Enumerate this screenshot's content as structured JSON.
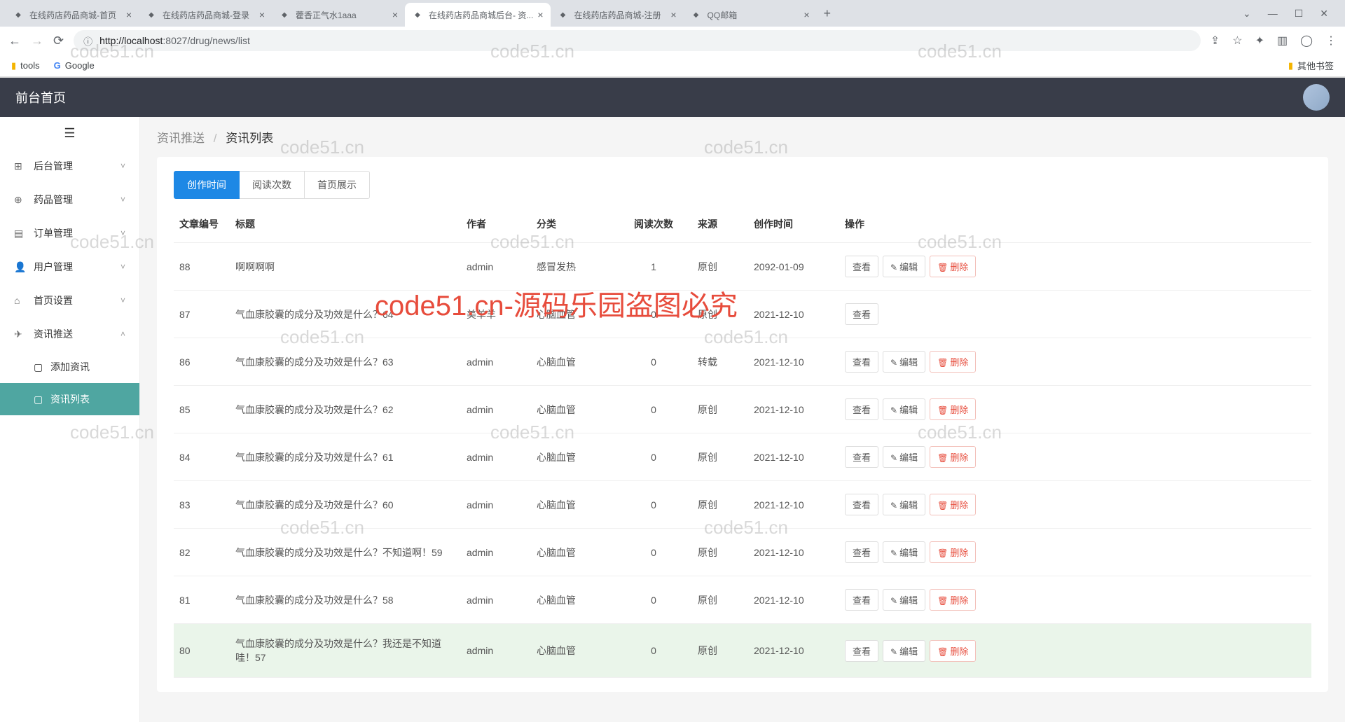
{
  "browser": {
    "tabs": [
      {
        "title": "在线药店药品商城-首页",
        "active": false
      },
      {
        "title": "在线药店药品商城-登录",
        "active": false
      },
      {
        "title": "藿香正气水1aaa",
        "active": false
      },
      {
        "title": "在线药店药品商城后台- 资...",
        "active": true
      },
      {
        "title": "在线药店药品商城-注册",
        "active": false
      },
      {
        "title": "QQ邮箱",
        "active": false
      }
    ],
    "url_host": "localhost",
    "url_port": ":8027",
    "url_path": "/drug/news/list",
    "bookmarks": [
      {
        "label": "tools"
      },
      {
        "label": "Google"
      }
    ],
    "other_bookmarks": "其他书签"
  },
  "header": {
    "title": "前台首页"
  },
  "sidebar": {
    "items": [
      {
        "label": "后台管理",
        "expanded": false
      },
      {
        "label": "药品管理",
        "expanded": false
      },
      {
        "label": "订单管理",
        "expanded": false
      },
      {
        "label": "用户管理",
        "expanded": false
      },
      {
        "label": "首页设置",
        "expanded": false
      },
      {
        "label": "资讯推送",
        "expanded": true
      }
    ],
    "subitems": [
      {
        "label": "添加资讯",
        "active": false
      },
      {
        "label": "资讯列表",
        "active": true
      }
    ]
  },
  "breadcrumb": {
    "parent": "资讯推送",
    "current": "资讯列表"
  },
  "filter_tabs": [
    {
      "label": "创作时间",
      "active": true
    },
    {
      "label": "阅读次数",
      "active": false
    },
    {
      "label": "首页展示",
      "active": false
    }
  ],
  "columns": {
    "id": "文章编号",
    "title": "标题",
    "author": "作者",
    "category": "分类",
    "reads": "阅读次数",
    "source": "来源",
    "created": "创作时间",
    "actions": "操作"
  },
  "action_labels": {
    "view": "查看",
    "edit": "编辑",
    "delete": "删除"
  },
  "rows": [
    {
      "id": "88",
      "title": "啊啊啊啊",
      "author": "admin",
      "category": "感冒发热",
      "reads": "1",
      "source": "原创",
      "created": "2092-01-09",
      "show_edit": true,
      "show_delete": true
    },
    {
      "id": "87",
      "title": "气血康胶囊的成分及功效是什么？64",
      "author": "美羊羊",
      "category": "心脑血管",
      "reads": "0",
      "source": "原创",
      "created": "2021-12-10",
      "show_edit": false,
      "show_delete": false
    },
    {
      "id": "86",
      "title": "气血康胶囊的成分及功效是什么？63",
      "author": "admin",
      "category": "心脑血管",
      "reads": "0",
      "source": "转载",
      "created": "2021-12-10",
      "show_edit": true,
      "show_delete": true
    },
    {
      "id": "85",
      "title": "气血康胶囊的成分及功效是什么？62",
      "author": "admin",
      "category": "心脑血管",
      "reads": "0",
      "source": "原创",
      "created": "2021-12-10",
      "show_edit": true,
      "show_delete": true
    },
    {
      "id": "84",
      "title": "气血康胶囊的成分及功效是什么？61",
      "author": "admin",
      "category": "心脑血管",
      "reads": "0",
      "source": "原创",
      "created": "2021-12-10",
      "show_edit": true,
      "show_delete": true
    },
    {
      "id": "83",
      "title": "气血康胶囊的成分及功效是什么？60",
      "author": "admin",
      "category": "心脑血管",
      "reads": "0",
      "source": "原创",
      "created": "2021-12-10",
      "show_edit": true,
      "show_delete": true
    },
    {
      "id": "82",
      "title": "气血康胶囊的成分及功效是什么？不知道啊！59",
      "author": "admin",
      "category": "心脑血管",
      "reads": "0",
      "source": "原创",
      "created": "2021-12-10",
      "show_edit": true,
      "show_delete": true
    },
    {
      "id": "81",
      "title": "气血康胶囊的成分及功效是什么？58",
      "author": "admin",
      "category": "心脑血管",
      "reads": "0",
      "source": "原创",
      "created": "2021-12-10",
      "show_edit": true,
      "show_delete": true
    },
    {
      "id": "80",
      "title": "气血康胶囊的成分及功效是什么？我还是不知道哇！57",
      "author": "admin",
      "category": "心脑血管",
      "reads": "0",
      "source": "原创",
      "created": "2021-12-10",
      "show_edit": true,
      "show_delete": true,
      "hover": true
    }
  ],
  "watermark_main": "code51.cn-源码乐园盗图必究",
  "watermark_small": "code51.cn"
}
